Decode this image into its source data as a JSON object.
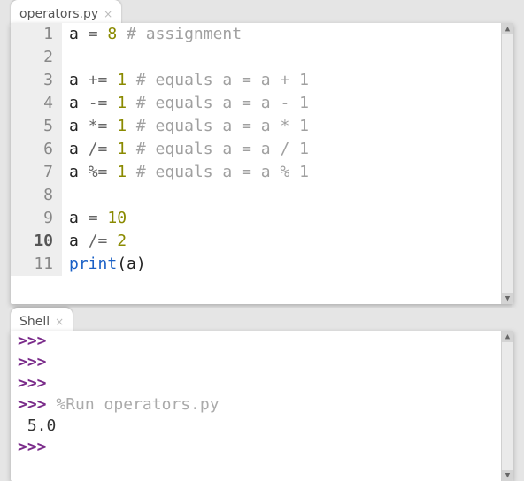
{
  "editor": {
    "tab_label": "operators.py",
    "lines": [
      {
        "n": "1",
        "bold": false,
        "tokens": [
          [
            "var",
            "a "
          ],
          [
            "op",
            "= "
          ],
          [
            "num",
            "8"
          ],
          [
            "cmt",
            " # assignment"
          ]
        ]
      },
      {
        "n": "2",
        "bold": false,
        "tokens": []
      },
      {
        "n": "3",
        "bold": false,
        "tokens": [
          [
            "var",
            "a "
          ],
          [
            "op",
            "+= "
          ],
          [
            "num",
            "1"
          ],
          [
            "cmt",
            " # equals a = a + 1"
          ]
        ]
      },
      {
        "n": "4",
        "bold": false,
        "tokens": [
          [
            "var",
            "a "
          ],
          [
            "op",
            "-= "
          ],
          [
            "num",
            "1"
          ],
          [
            "cmt",
            " # equals a = a - 1"
          ]
        ]
      },
      {
        "n": "5",
        "bold": false,
        "tokens": [
          [
            "var",
            "a "
          ],
          [
            "op",
            "*= "
          ],
          [
            "num",
            "1"
          ],
          [
            "cmt",
            " # equals a = a * 1"
          ]
        ]
      },
      {
        "n": "6",
        "bold": false,
        "tokens": [
          [
            "var",
            "a "
          ],
          [
            "op",
            "/= "
          ],
          [
            "num",
            "1"
          ],
          [
            "cmt",
            " # equals a = a / 1"
          ]
        ]
      },
      {
        "n": "7",
        "bold": false,
        "tokens": [
          [
            "var",
            "a "
          ],
          [
            "op",
            "%= "
          ],
          [
            "num",
            "1"
          ],
          [
            "cmt",
            " # equals a = a % 1"
          ]
        ]
      },
      {
        "n": "8",
        "bold": false,
        "tokens": []
      },
      {
        "n": "9",
        "bold": false,
        "tokens": [
          [
            "var",
            "a "
          ],
          [
            "op",
            "= "
          ],
          [
            "num",
            "10"
          ]
        ]
      },
      {
        "n": "10",
        "bold": true,
        "tokens": [
          [
            "var",
            "a "
          ],
          [
            "op",
            "/= "
          ],
          [
            "num",
            "2"
          ]
        ]
      },
      {
        "n": "11",
        "bold": false,
        "tokens": [
          [
            "func",
            "print"
          ],
          [
            "paren",
            "("
          ],
          [
            "var",
            "a"
          ],
          [
            "paren",
            ")"
          ]
        ]
      }
    ]
  },
  "shell": {
    "tab_label": "Shell",
    "rows": [
      {
        "type": "prompt-only",
        "prompt": ">>>"
      },
      {
        "type": "prompt-only",
        "prompt": ">>>"
      },
      {
        "type": "prompt-only",
        "prompt": ">>>"
      },
      {
        "type": "prompt-cmd",
        "prompt": ">>>",
        "cmd": "%Run operators.py"
      },
      {
        "type": "result",
        "text": " 5.0"
      },
      {
        "type": "prompt-caret",
        "prompt": ">>>"
      }
    ]
  }
}
